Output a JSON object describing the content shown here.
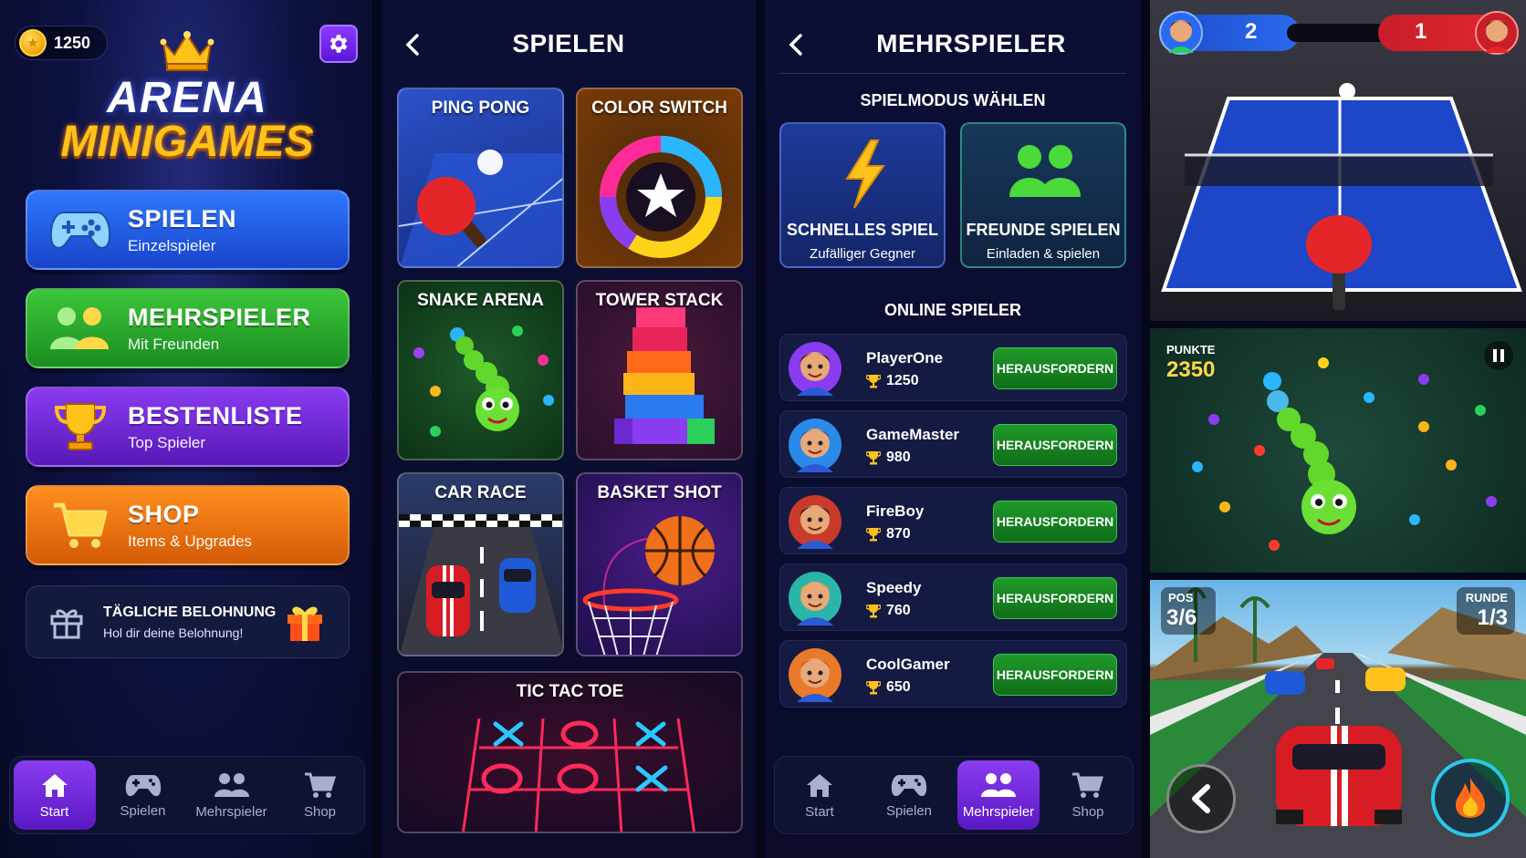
{
  "menu_screen": {
    "coins": "1250",
    "logo_line1": "ARENA",
    "logo_line2": "MINIGAMES",
    "buttons": [
      {
        "title": "SPIELEN",
        "subtitle": "Einzelspieler"
      },
      {
        "title": "MEHRSPIELER",
        "subtitle": "Mit Freunden"
      },
      {
        "title": "BESTENLISTE",
        "subtitle": "Top Spieler"
      },
      {
        "title": "SHOP",
        "subtitle": "Items & Upgrades"
      }
    ],
    "daily": {
      "title": "TÄGLICHE BELOHNUNG",
      "subtitle": "Hol dir deine Belohnung!"
    }
  },
  "nav": {
    "start": "Start",
    "play": "Spielen",
    "multi": "Mehrspieler",
    "shop": "Shop"
  },
  "games_screen": {
    "title": "SPIELEN",
    "games": [
      "PING PONG",
      "COLOR SWITCH",
      "SNAKE ARENA",
      "TOWER STACK",
      "CAR RACE",
      "BASKET SHOT",
      "TIC TAC TOE"
    ]
  },
  "multi_screen": {
    "title": "MEHRSPIELER",
    "mode_heading": "SPIELMODUS WÄHLEN",
    "modes": [
      {
        "title": "SCHNELLES SPIEL",
        "subtitle": "Zufälliger Gegner"
      },
      {
        "title": "FREUNDE SPIELEN",
        "subtitle": "Einladen & spielen"
      }
    ],
    "online_heading": "ONLINE SPIELER",
    "challenge_label": "HERAUSFORDERN",
    "players": [
      {
        "name": "PlayerOne",
        "score": "1250"
      },
      {
        "name": "GameMaster",
        "score": "980"
      },
      {
        "name": "FireBoy",
        "score": "870"
      },
      {
        "name": "Speedy",
        "score": "760"
      },
      {
        "name": "CoolGamer",
        "score": "650"
      }
    ]
  },
  "gameplay": {
    "pingpong": {
      "score_blue": "2",
      "score_red": "1"
    },
    "snake": {
      "points_label": "PUNKTE",
      "points": "2350"
    },
    "race": {
      "pos_label": "POS",
      "pos": "3/6",
      "lap_label": "RUNDE",
      "lap": "1/3"
    }
  },
  "colors": {
    "blue": "#2f78ff",
    "green": "#2aa82f",
    "purple": "#7a2fe0",
    "orange": "#f07414",
    "accent": "#ffc21b"
  }
}
